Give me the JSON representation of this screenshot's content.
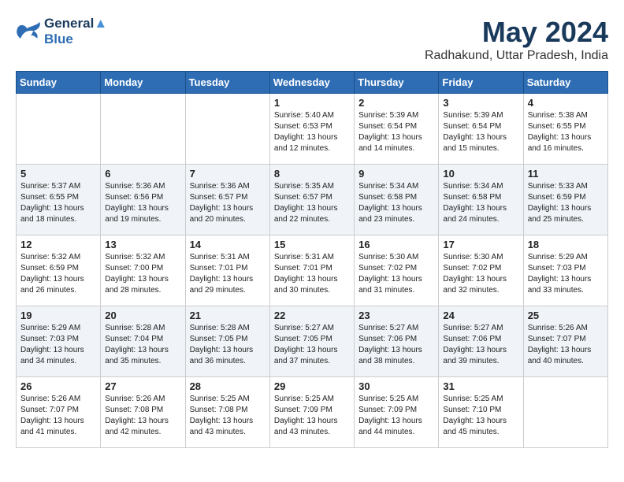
{
  "header": {
    "logo_line1": "General",
    "logo_line2": "Blue",
    "month": "May 2024",
    "location": "Radhakund, Uttar Pradesh, India"
  },
  "weekdays": [
    "Sunday",
    "Monday",
    "Tuesday",
    "Wednesday",
    "Thursday",
    "Friday",
    "Saturday"
  ],
  "weeks": [
    [
      {
        "day": "",
        "sunrise": "",
        "sunset": "",
        "daylight": ""
      },
      {
        "day": "",
        "sunrise": "",
        "sunset": "",
        "daylight": ""
      },
      {
        "day": "",
        "sunrise": "",
        "sunset": "",
        "daylight": ""
      },
      {
        "day": "1",
        "sunrise": "Sunrise: 5:40 AM",
        "sunset": "Sunset: 6:53 PM",
        "daylight": "Daylight: 13 hours and 12 minutes."
      },
      {
        "day": "2",
        "sunrise": "Sunrise: 5:39 AM",
        "sunset": "Sunset: 6:54 PM",
        "daylight": "Daylight: 13 hours and 14 minutes."
      },
      {
        "day": "3",
        "sunrise": "Sunrise: 5:39 AM",
        "sunset": "Sunset: 6:54 PM",
        "daylight": "Daylight: 13 hours and 15 minutes."
      },
      {
        "day": "4",
        "sunrise": "Sunrise: 5:38 AM",
        "sunset": "Sunset: 6:55 PM",
        "daylight": "Daylight: 13 hours and 16 minutes."
      }
    ],
    [
      {
        "day": "5",
        "sunrise": "Sunrise: 5:37 AM",
        "sunset": "Sunset: 6:55 PM",
        "daylight": "Daylight: 13 hours and 18 minutes."
      },
      {
        "day": "6",
        "sunrise": "Sunrise: 5:36 AM",
        "sunset": "Sunset: 6:56 PM",
        "daylight": "Daylight: 13 hours and 19 minutes."
      },
      {
        "day": "7",
        "sunrise": "Sunrise: 5:36 AM",
        "sunset": "Sunset: 6:57 PM",
        "daylight": "Daylight: 13 hours and 20 minutes."
      },
      {
        "day": "8",
        "sunrise": "Sunrise: 5:35 AM",
        "sunset": "Sunset: 6:57 PM",
        "daylight": "Daylight: 13 hours and 22 minutes."
      },
      {
        "day": "9",
        "sunrise": "Sunrise: 5:34 AM",
        "sunset": "Sunset: 6:58 PM",
        "daylight": "Daylight: 13 hours and 23 minutes."
      },
      {
        "day": "10",
        "sunrise": "Sunrise: 5:34 AM",
        "sunset": "Sunset: 6:58 PM",
        "daylight": "Daylight: 13 hours and 24 minutes."
      },
      {
        "day": "11",
        "sunrise": "Sunrise: 5:33 AM",
        "sunset": "Sunset: 6:59 PM",
        "daylight": "Daylight: 13 hours and 25 minutes."
      }
    ],
    [
      {
        "day": "12",
        "sunrise": "Sunrise: 5:32 AM",
        "sunset": "Sunset: 6:59 PM",
        "daylight": "Daylight: 13 hours and 26 minutes."
      },
      {
        "day": "13",
        "sunrise": "Sunrise: 5:32 AM",
        "sunset": "Sunset: 7:00 PM",
        "daylight": "Daylight: 13 hours and 28 minutes."
      },
      {
        "day": "14",
        "sunrise": "Sunrise: 5:31 AM",
        "sunset": "Sunset: 7:01 PM",
        "daylight": "Daylight: 13 hours and 29 minutes."
      },
      {
        "day": "15",
        "sunrise": "Sunrise: 5:31 AM",
        "sunset": "Sunset: 7:01 PM",
        "daylight": "Daylight: 13 hours and 30 minutes."
      },
      {
        "day": "16",
        "sunrise": "Sunrise: 5:30 AM",
        "sunset": "Sunset: 7:02 PM",
        "daylight": "Daylight: 13 hours and 31 minutes."
      },
      {
        "day": "17",
        "sunrise": "Sunrise: 5:30 AM",
        "sunset": "Sunset: 7:02 PM",
        "daylight": "Daylight: 13 hours and 32 minutes."
      },
      {
        "day": "18",
        "sunrise": "Sunrise: 5:29 AM",
        "sunset": "Sunset: 7:03 PM",
        "daylight": "Daylight: 13 hours and 33 minutes."
      }
    ],
    [
      {
        "day": "19",
        "sunrise": "Sunrise: 5:29 AM",
        "sunset": "Sunset: 7:03 PM",
        "daylight": "Daylight: 13 hours and 34 minutes."
      },
      {
        "day": "20",
        "sunrise": "Sunrise: 5:28 AM",
        "sunset": "Sunset: 7:04 PM",
        "daylight": "Daylight: 13 hours and 35 minutes."
      },
      {
        "day": "21",
        "sunrise": "Sunrise: 5:28 AM",
        "sunset": "Sunset: 7:05 PM",
        "daylight": "Daylight: 13 hours and 36 minutes."
      },
      {
        "day": "22",
        "sunrise": "Sunrise: 5:27 AM",
        "sunset": "Sunset: 7:05 PM",
        "daylight": "Daylight: 13 hours and 37 minutes."
      },
      {
        "day": "23",
        "sunrise": "Sunrise: 5:27 AM",
        "sunset": "Sunset: 7:06 PM",
        "daylight": "Daylight: 13 hours and 38 minutes."
      },
      {
        "day": "24",
        "sunrise": "Sunrise: 5:27 AM",
        "sunset": "Sunset: 7:06 PM",
        "daylight": "Daylight: 13 hours and 39 minutes."
      },
      {
        "day": "25",
        "sunrise": "Sunrise: 5:26 AM",
        "sunset": "Sunset: 7:07 PM",
        "daylight": "Daylight: 13 hours and 40 minutes."
      }
    ],
    [
      {
        "day": "26",
        "sunrise": "Sunrise: 5:26 AM",
        "sunset": "Sunset: 7:07 PM",
        "daylight": "Daylight: 13 hours and 41 minutes."
      },
      {
        "day": "27",
        "sunrise": "Sunrise: 5:26 AM",
        "sunset": "Sunset: 7:08 PM",
        "daylight": "Daylight: 13 hours and 42 minutes."
      },
      {
        "day": "28",
        "sunrise": "Sunrise: 5:25 AM",
        "sunset": "Sunset: 7:08 PM",
        "daylight": "Daylight: 13 hours and 43 minutes."
      },
      {
        "day": "29",
        "sunrise": "Sunrise: 5:25 AM",
        "sunset": "Sunset: 7:09 PM",
        "daylight": "Daylight: 13 hours and 43 minutes."
      },
      {
        "day": "30",
        "sunrise": "Sunrise: 5:25 AM",
        "sunset": "Sunset: 7:09 PM",
        "daylight": "Daylight: 13 hours and 44 minutes."
      },
      {
        "day": "31",
        "sunrise": "Sunrise: 5:25 AM",
        "sunset": "Sunset: 7:10 PM",
        "daylight": "Daylight: 13 hours and 45 minutes."
      },
      {
        "day": "",
        "sunrise": "",
        "sunset": "",
        "daylight": ""
      }
    ]
  ]
}
